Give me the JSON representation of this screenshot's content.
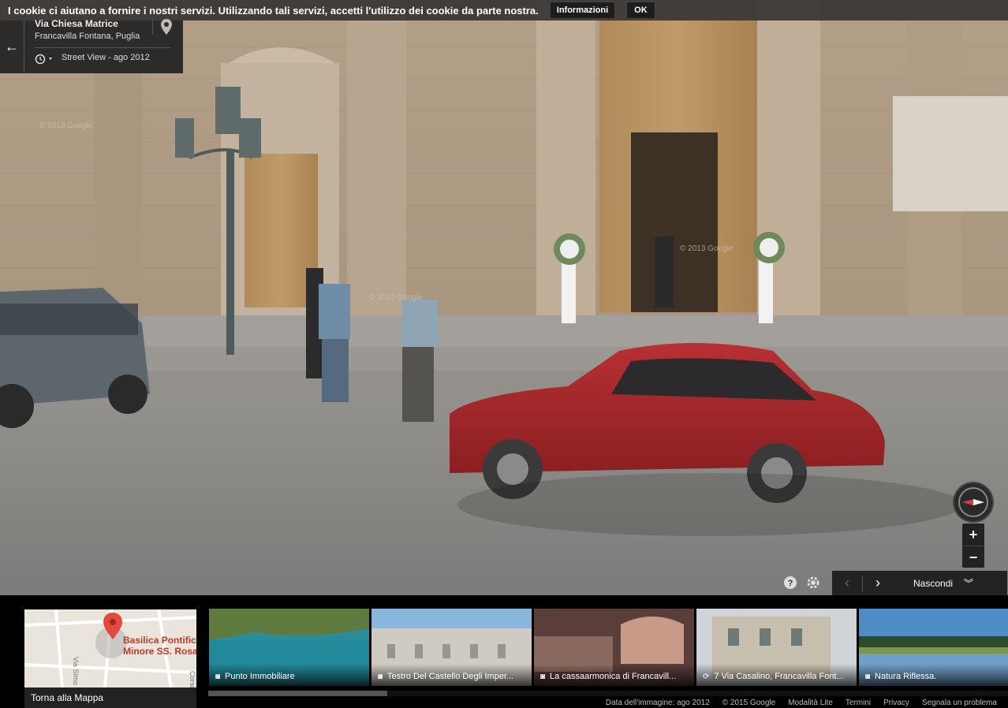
{
  "cookie_bar": {
    "message": "I cookie ci aiutano a fornire i nostri servizi. Utilizzando tali servizi, accetti l'utilizzo dei cookie da parte nostra.",
    "info_label": "Informazioni",
    "ok_label": "OK"
  },
  "location": {
    "street": "Via Chiesa Matrice",
    "city": "Francavilla Fontana, Puglia",
    "imagery": "Street View - ago 2012"
  },
  "watermark": "© 2013 Google",
  "controls": {
    "zoom_in": "+",
    "zoom_out": "−",
    "hide_label": "Nascondi"
  },
  "minimap": {
    "place_line1": "Basilica Pontific",
    "place_line2": "Minore SS. Rosa",
    "street_label": "Via Simo",
    "street_label2": "Corso",
    "back_label": "Torna alla Mappa"
  },
  "thumbnails": [
    {
      "title": "Punto Immobiliare",
      "icon": "camera-icon"
    },
    {
      "title": "Testro Del Castello Degli Imper...",
      "icon": "camera-icon"
    },
    {
      "title": "La cassaarmonica di Francavill...",
      "icon": "camera-icon"
    },
    {
      "title": "7 Via Casalino, Francavilla Font...",
      "icon": "panorama-icon"
    },
    {
      "title": "Natura Riflessa.",
      "icon": "camera-icon"
    }
  ],
  "footer": {
    "image_date": "Data dell'immagine: ago 2012",
    "copyright": "© 2015 Google",
    "lite": "Modalità Lite",
    "terms": "Termini",
    "privacy": "Privacy",
    "report": "Segnala un problema"
  },
  "colors": {
    "car": "#a8292b",
    "building": "#b7a58f"
  }
}
